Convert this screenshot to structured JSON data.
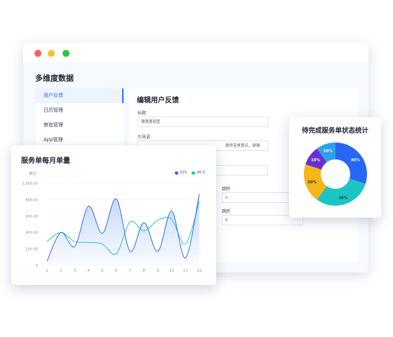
{
  "window": {
    "page_title": "多维度数据"
  },
  "sidebar": {
    "items": [
      {
        "label": "用户反馈"
      },
      {
        "label": "日历管理"
      },
      {
        "label": "审批管理"
      },
      {
        "label": "App管理"
      }
    ]
  },
  "form": {
    "title": "编辑用户反馈",
    "field1_label": "标题",
    "field1_value": "满意度调查",
    "field2_label": "引导语",
    "field2_value": "提供宝贵意见，谢谢",
    "field3_label": "跳转",
    "field3_value": "2",
    "field4_label": "跳转",
    "field4_value": "5"
  },
  "colors": {
    "ios": "#2a6df4",
    "bcs": "#1fc6bf",
    "pie_blue": "#2866f6",
    "pie_cyan": "#1cc5c3",
    "pie_yellow": "#f6b519",
    "pie_purple": "#6a2fcf",
    "pie_lightblue": "#2ea0ee"
  },
  "chart_data": [
    {
      "type": "line",
      "title": "服务单每月单量",
      "ylabel": "单位",
      "x": [
        "1",
        "2",
        "3",
        "4",
        "5",
        "6",
        "7",
        "8",
        "9",
        "10",
        "11",
        "12"
      ],
      "y_ticks": [
        "0",
        "200.00",
        "400.00",
        "600.00",
        "800.00",
        "1,000.00"
      ],
      "ylim": [
        0,
        1000
      ],
      "legend_position": "top-right",
      "series": [
        {
          "name": "IOS",
          "values": [
            50,
            400,
            230,
            720,
            390,
            810,
            170,
            520,
            170,
            660,
            90,
            870
          ]
        },
        {
          "name": "BCS",
          "values": [
            290,
            400,
            290,
            280,
            260,
            140,
            530,
            420,
            550,
            560,
            260,
            780
          ]
        }
      ]
    },
    {
      "type": "pie",
      "title": "待完成服务单状态统计",
      "slices": [
        {
          "label": "30%",
          "value": 30
        },
        {
          "label": "30%",
          "value": 30
        },
        {
          "label": "20%",
          "value": 20
        },
        {
          "label": "10%",
          "value": 10
        },
        {
          "label": "10%",
          "value": 10
        }
      ]
    }
  ]
}
